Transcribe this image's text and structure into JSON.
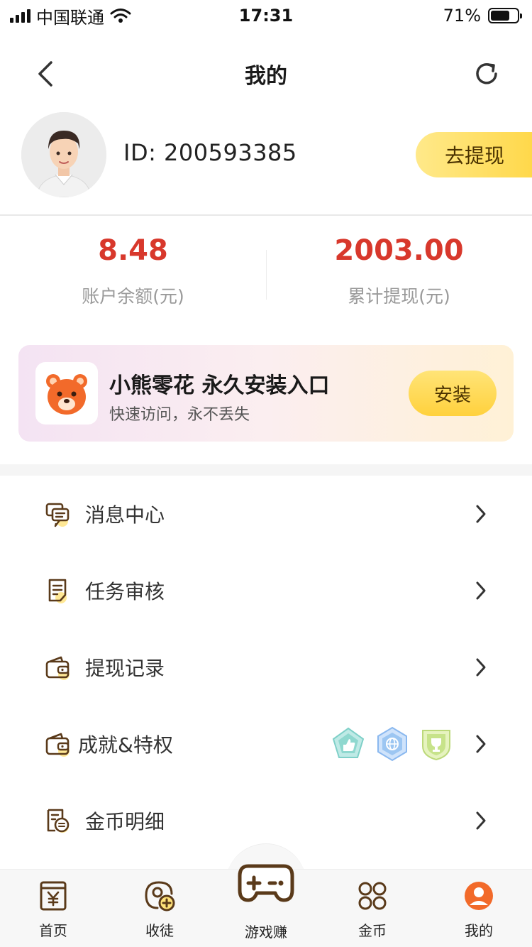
{
  "status_bar": {
    "carrier": "中国联通",
    "time": "17:31",
    "battery_percent": "71%",
    "battery_level": 0.71
  },
  "header": {
    "title": "我的",
    "back_icon": "chevron-left-icon",
    "refresh_icon": "refresh-icon"
  },
  "profile": {
    "user_id": "ID: 200593385",
    "withdraw_label": "去提现"
  },
  "stats": {
    "balance_value": "8.48",
    "balance_label": "账户余额(元)",
    "total_withdraw_value": "2003.00",
    "total_withdraw_label": "累计提现(元)"
  },
  "install_banner": {
    "title": "小熊零花 永久安装入口",
    "subtitle": "快速访问，永不丢失",
    "button_label": "安装"
  },
  "menu": {
    "items": [
      {
        "label": "消息中心",
        "icon": "message-icon"
      },
      {
        "label": "任务审核",
        "icon": "task-review-icon"
      },
      {
        "label": "提现记录",
        "icon": "wallet-icon"
      },
      {
        "label": "成就&特权",
        "icon": "wallet-icon"
      },
      {
        "label": "金币明细",
        "icon": "coin-detail-icon"
      }
    ]
  },
  "tabbar": {
    "items": [
      {
        "label": "首页",
        "icon": "home-yen-icon"
      },
      {
        "label": "收徒",
        "icon": "add-friend-icon"
      },
      {
        "label": "游戏赚",
        "icon": "gamepad-icon"
      },
      {
        "label": "金币",
        "icon": "grid-icon"
      },
      {
        "label": "我的",
        "icon": "profile-icon"
      }
    ]
  },
  "colors": {
    "accent_yellow": "#ffd84a",
    "value_red": "#d8382c",
    "icon_brown": "#5a3a1a"
  }
}
